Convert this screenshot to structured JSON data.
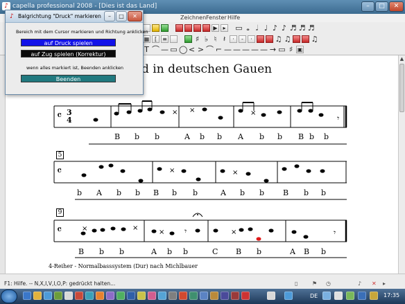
{
  "window": {
    "title": "capella professional 2008 - [Dies ist das Land]"
  },
  "menu": [
    "Zeichnen",
    "Fenster",
    "Hilfe"
  ],
  "dialog": {
    "title": "Balgrichtung \"Druck\" markieren",
    "instruction": "Bereich mit dem Cursor markieren und Richtung anklicken",
    "btn_push": "auf Druck spielen",
    "btn_pull": "auf Zug spielen (Korrektur)",
    "hint": "wenn alles markiert ist, Beenden anklicken",
    "btn_finish": "Beenden"
  },
  "score": {
    "heading": "d in deutschen Gauen",
    "time_signature": "3/4",
    "system1": {
      "bar_number": "",
      "labels": [
        "B",
        "b",
        "b",
        "A",
        "b",
        "b",
        "A",
        "b",
        "b",
        "B",
        "b",
        "b"
      ]
    },
    "system2": {
      "bar_number": "5",
      "labels": [
        "b",
        "A",
        "b",
        "b",
        "B",
        "b",
        "b",
        "A",
        "b",
        "b",
        "B",
        "b",
        "b"
      ]
    },
    "system3": {
      "bar_number": "9",
      "labels": [
        "B",
        "b",
        "b",
        "A",
        "b",
        "b",
        "C",
        "B",
        "b",
        "A",
        "B",
        "b"
      ]
    },
    "footer": "4-Reiher - Normalbasssystem (Dur) nach Michlbauer"
  },
  "status": {
    "text": "F1: Hilfe. -- N,X,I,V,I,O,P: gedrückt halten..."
  },
  "taskbar": {
    "language": "DE",
    "time": "17:35"
  },
  "colors": {
    "push_button": "#1212e8",
    "pull_button": "#0b0b0b",
    "finish_button": "#21797f",
    "highlight_note": "#e01818"
  },
  "icons": [
    "app-icon",
    "minimize-icon",
    "maximize-icon",
    "close-icon",
    "start-orb-icon",
    "clock-icon"
  ]
}
